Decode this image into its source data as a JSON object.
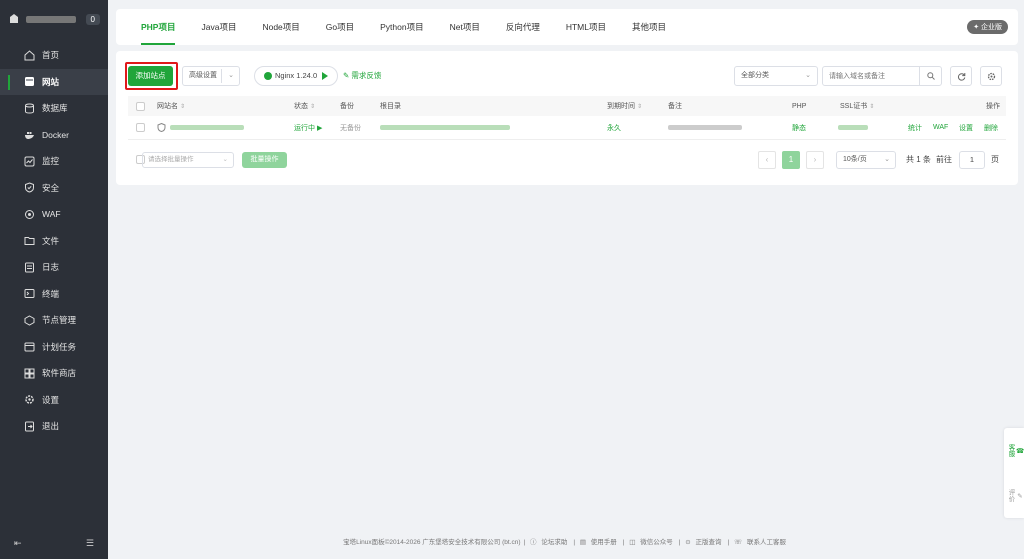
{
  "sidebar": {
    "badge": "0",
    "items": [
      {
        "label": "首页",
        "icon": "home-icon"
      },
      {
        "label": "网站",
        "icon": "website-icon",
        "active": true
      },
      {
        "label": "数据库",
        "icon": "database-icon"
      },
      {
        "label": "Docker",
        "icon": "docker-icon"
      },
      {
        "label": "监控",
        "icon": "monitor-icon"
      },
      {
        "label": "安全",
        "icon": "shield-icon"
      },
      {
        "label": "WAF",
        "icon": "waf-icon"
      },
      {
        "label": "文件",
        "icon": "folder-icon"
      },
      {
        "label": "日志",
        "icon": "log-icon"
      },
      {
        "label": "终端",
        "icon": "terminal-icon"
      },
      {
        "label": "节点管理",
        "icon": "node-icon"
      },
      {
        "label": "计划任务",
        "icon": "calendar-icon"
      },
      {
        "label": "软件商店",
        "icon": "store-icon"
      },
      {
        "label": "设置",
        "icon": "gear-icon"
      },
      {
        "label": "退出",
        "icon": "logout-icon"
      }
    ]
  },
  "tabs": [
    "PHP项目",
    "Java项目",
    "Node项目",
    "Go项目",
    "Python项目",
    "Net项目",
    "反向代理",
    "HTML项目",
    "其他项目"
  ],
  "edition": "企业版",
  "toolbar": {
    "add_site": "添加站点",
    "advanced": "高级设置",
    "nginx": "Nginx 1.24.0",
    "feedback": "需求反馈",
    "category": "全部分类",
    "search_placeholder": "请输入域名或备注"
  },
  "table": {
    "headers": {
      "name": "网站名",
      "status": "状态",
      "backup": "备份",
      "root": "根目录",
      "expire": "到期时间",
      "remark": "备注",
      "php": "PHP",
      "ssl": "SSL证书",
      "ops": "操作"
    },
    "row": {
      "status": "运行中",
      "backup": "无备份",
      "expire": "永久",
      "php": "静态",
      "ops": [
        "统计",
        "WAF",
        "设置",
        "删除"
      ]
    }
  },
  "pagination": {
    "batch_placeholder": "请选择批量操作",
    "batch_button": "批量操作",
    "prev": "‹",
    "current": "1",
    "next": "›",
    "page_size": "10条/页",
    "total": "共 1 条",
    "goto": "前往",
    "goto_value": "1",
    "page_unit": "页"
  },
  "footer": {
    "copyright": "宝塔Linux面板©2014-2026 广东堡塔安全技术有限公司 (bt.cn)",
    "links": [
      "论坛求助",
      "使用手册",
      "微信公众号",
      "正版查询",
      "联系人工客服"
    ]
  },
  "float": {
    "service": "客服",
    "review": "评价"
  },
  "colors": {
    "accent": "#20a53a",
    "sidebar_bg": "#2c3038",
    "highlight": "#e0181a"
  }
}
